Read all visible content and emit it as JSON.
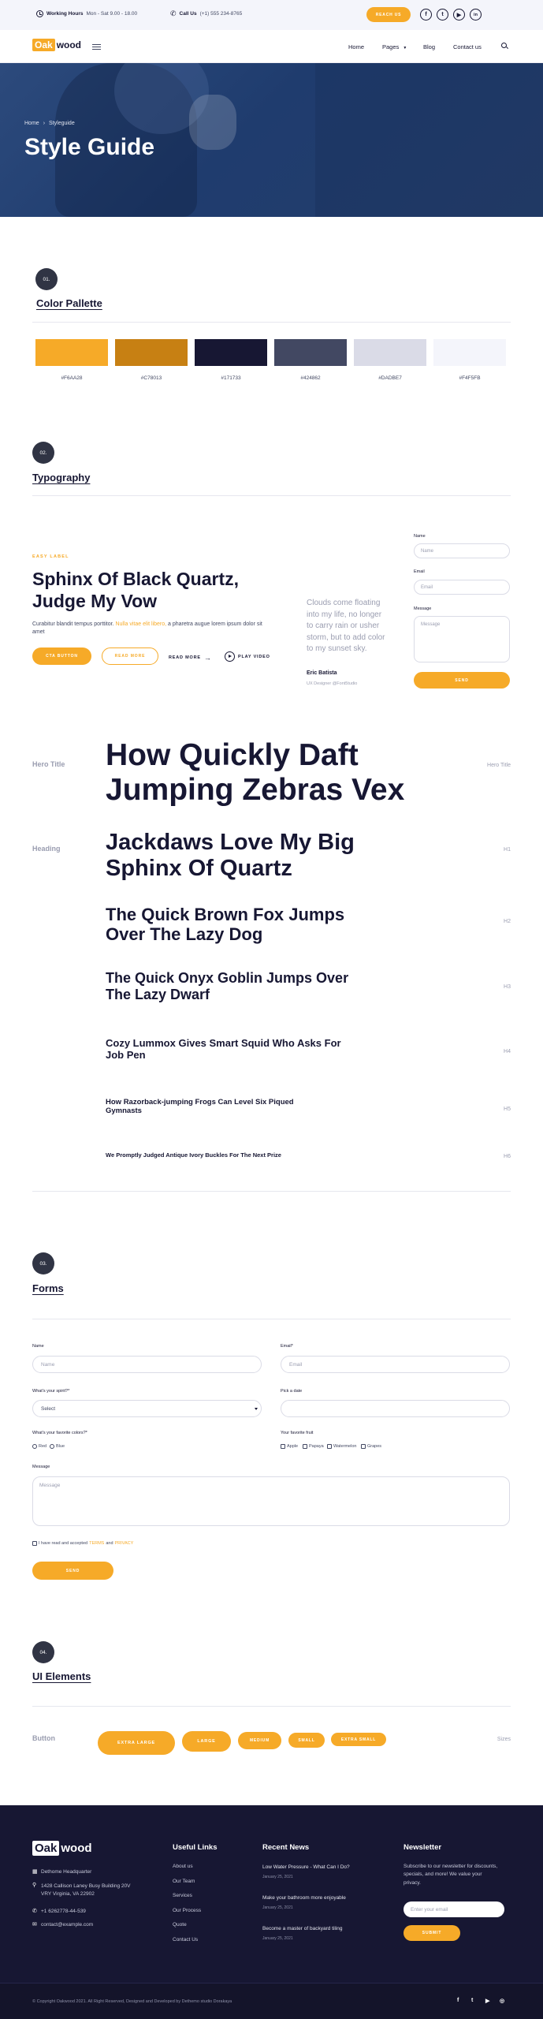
{
  "topbar": {
    "hours_label": "Working Hours",
    "hours_value": "Mon - Sat 9.00 - 18.00",
    "call_label": "Call Us",
    "call_value": "(+1) 555 234-8765",
    "reach_label": "REACH US",
    "social": [
      "f",
      "t",
      "▶",
      "in"
    ]
  },
  "brand": {
    "oak": "Oak",
    "wood": "wood"
  },
  "nav": {
    "home": "Home",
    "pages": "Pages",
    "blog": "Blog",
    "contact": "Contact us"
  },
  "hero": {
    "crumb_home": "Home",
    "crumb_sep": "›",
    "crumb_current": "Styleguide",
    "title": "Style Guide"
  },
  "palette": {
    "badge": "01.",
    "title": "Color Pallette",
    "colors": [
      "#F6AA28",
      "#C78013",
      "#171733",
      "#424862",
      "#DADBE7",
      "#F4F5FB"
    ],
    "labels": [
      "#F6AA28",
      "#C78013",
      "#171733",
      "#424862",
      "#DADBE7",
      "#F4F5FB"
    ]
  },
  "typography": {
    "badge": "02.",
    "title": "Typography",
    "kicker": "EASY LABEL",
    "heading": "Sphinx Of Black Quartz, Judge My Vow",
    "para_before": "Curabitur blandit tempus porttitor.",
    "para_link": "Nulla vitae elit libero,",
    "para_after": "a pharetra augue lorem ipsum dolor sit amet",
    "btn_cta": "CTA BUTTON",
    "btn_read": "READ MORE",
    "btn_read2": "READ MORE",
    "btn_play": "PLAY VIDEO",
    "quote": "Clouds come floating into my life, no longer to carry rain or usher storm, but to add color to my sunset sky.",
    "quote_name": "Eric Batista",
    "quote_role": "UX Designer @Font5tudio",
    "form_name_label": "Name",
    "form_name_ph": "Name",
    "form_email_label": "Email",
    "form_email_ph": "Email",
    "form_msg_label": "Message",
    "form_msg_ph": "Message",
    "form_send": "SEND"
  },
  "scale": {
    "hero_label": "Hero Title",
    "hero_right": "Hero Title",
    "heading_label": "Heading",
    "hero_text": "How Quickly Daft Jumping Zebras Vex",
    "h1": "Jackdaws Love My Big Sphinx Of Quartz",
    "h2": "The Quick Brown Fox Jumps Over The Lazy Dog",
    "h3": "The Quick Onyx Goblin Jumps Over The Lazy Dwarf",
    "h4": "Cozy Lummox Gives Smart Squid Who Asks For Job Pen",
    "h5": "How Razorback-jumping Frogs Can Level Six Piqued Gymnasts",
    "h6": "We Promptly Judged Antique Ivory Buckles For The Next Prize",
    "tags": [
      "H1",
      "H2",
      "H3",
      "H4",
      "H5",
      "H6"
    ]
  },
  "forms": {
    "badge": "03.",
    "title": "Forms",
    "name_label": "Name",
    "name_ph": "Name",
    "email_label": "Email*",
    "email_ph": "Email",
    "spirit_label": "What's your spirit?*",
    "spirit_value": "Select",
    "date_label": "Pick a date",
    "color_label": "What's your favorite colors?*",
    "colors": [
      "Red",
      "Blue"
    ],
    "fruit_label": "Your favorite fruit",
    "fruits": [
      "Apple",
      "Papaya",
      "Watermelon",
      "Grapes"
    ],
    "message_label": "Message",
    "message_ph": "Message",
    "terms_before": "I have read and accepted",
    "terms_link1": "TERMS",
    "terms_and": "and",
    "terms_link2": "PRIVACY",
    "send": "SEND"
  },
  "ui": {
    "badge": "04.",
    "title": "UI Elements",
    "button_label": "Button",
    "sizes_label": "Sizes",
    "buttons": [
      "EXTRA LARGE",
      "LARGE",
      "MEDIUM",
      "SMALL",
      "EXTRA SMALL"
    ]
  },
  "footer": {
    "oak": "Oak",
    "wood": "wood",
    "hq": "Dethome Headquarter",
    "address": "1428 Callison Laney Busy Building 20V VRY Virginia, VA 22902",
    "phone": "+1 6262778-44-539",
    "email": "contact@example.com",
    "links_title": "Useful Links",
    "links": [
      "About us",
      "Our Team",
      "Services",
      "Our Process",
      "Quote",
      "Contact Us"
    ],
    "news_title": "Recent News",
    "news": [
      {
        "title": "Low Water Pressure - What Can I Do?",
        "date": "January 25, 2021"
      },
      {
        "title": "Make your bathroom more enjoyable",
        "date": "January 25, 2021"
      },
      {
        "title": "Become a master of backyard tiling",
        "date": "January 25, 2021"
      }
    ],
    "newsletter_title": "Newsletter",
    "newsletter_text": "Subscribe to our newsletter for discounts, specials, and more! We value your privacy.",
    "newsletter_ph": "Enter your email",
    "submit": "SUBMIT",
    "copyright": "© Copyright Oakwood 2021. All Right Reserved, Designed and Developed by Dethemo studio Dorakaya",
    "social": [
      "f",
      "t",
      "▶",
      "◎"
    ]
  }
}
